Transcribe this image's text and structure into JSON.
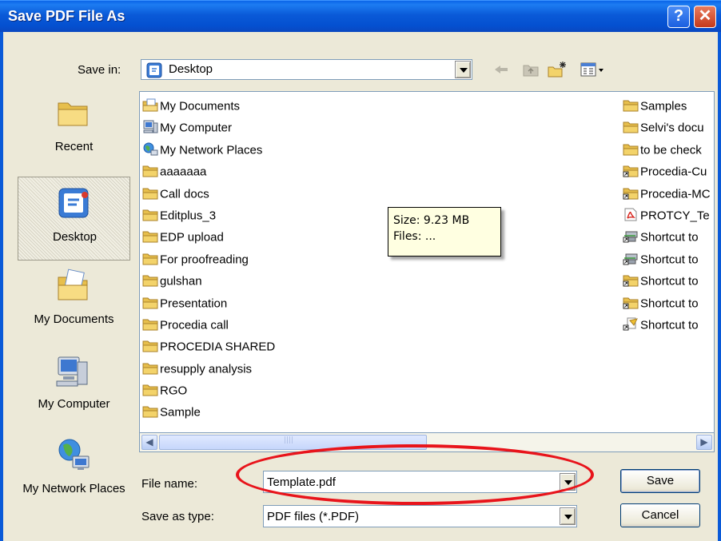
{
  "window": {
    "title": "Save PDF File As",
    "help_glyph": "?",
    "close_glyph": "✕"
  },
  "savein": {
    "label": "Save in:",
    "value": "Desktop"
  },
  "toolbar": {
    "icons": [
      "back-arrow-icon",
      "up-folder-icon",
      "new-folder-icon",
      "views-menu-icon"
    ]
  },
  "places": [
    {
      "label": "Recent",
      "icon": "recent-folder-icon"
    },
    {
      "label": "Desktop",
      "icon": "desktop-icon",
      "selected": true
    },
    {
      "label": "My Documents",
      "icon": "my-documents-icon"
    },
    {
      "label": "My Computer",
      "icon": "my-computer-icon"
    },
    {
      "label": "My Network Places",
      "icon": "network-places-icon"
    }
  ],
  "files": {
    "left_column": [
      {
        "name": "My Documents",
        "icon": "my-documents-icon"
      },
      {
        "name": "My Computer",
        "icon": "my-computer-icon"
      },
      {
        "name": "My Network Places",
        "icon": "network-places-icon"
      },
      {
        "name": "aaaaaaa",
        "icon": "folder-icon"
      },
      {
        "name": "Call docs",
        "icon": "folder-icon"
      },
      {
        "name": "Editplus_3",
        "icon": "folder-icon"
      },
      {
        "name": "EDP upload",
        "icon": "folder-icon"
      },
      {
        "name": "For proofreading",
        "icon": "folder-icon"
      },
      {
        "name": "gulshan",
        "icon": "folder-icon"
      },
      {
        "name": "Presentation",
        "icon": "folder-icon"
      },
      {
        "name": "Procedia call",
        "icon": "folder-icon"
      },
      {
        "name": "PROCEDIA SHARED",
        "icon": "folder-icon"
      },
      {
        "name": "resupply analysis",
        "icon": "folder-icon"
      },
      {
        "name": "RGO",
        "icon": "folder-icon"
      },
      {
        "name": "Sample",
        "icon": "folder-icon"
      }
    ],
    "right_column": [
      {
        "name": "Samples",
        "icon": "folder-icon"
      },
      {
        "name": "Selvi's docu",
        "icon": "folder-icon"
      },
      {
        "name": "to be check",
        "icon": "folder-icon"
      },
      {
        "name": "Procedia-Cu",
        "icon": "folder-shortcut-icon"
      },
      {
        "name": "Procedia-MC",
        "icon": "folder-shortcut-icon"
      },
      {
        "name": "PROTCY_Te",
        "icon": "pdf-file-icon"
      },
      {
        "name": "Shortcut to",
        "icon": "network-shortcut-icon"
      },
      {
        "name": "Shortcut to",
        "icon": "network-shortcut-icon"
      },
      {
        "name": "Shortcut to",
        "icon": "folder-shortcut-icon"
      },
      {
        "name": "Shortcut to",
        "icon": "folder-shortcut-icon"
      },
      {
        "name": "Shortcut to",
        "icon": "file-shortcut-icon"
      }
    ]
  },
  "tooltip": {
    "line1": "Size: 9.23 MB",
    "line2": "Files: ..."
  },
  "form": {
    "filename_label": "File name:",
    "filename_value": "Template.pdf",
    "type_label": "Save as type:",
    "type_value": "PDF files (*.PDF)",
    "save_label": "Save",
    "cancel_label": "Cancel"
  },
  "colors": {
    "titlebar": "#0a5ad8",
    "dialog_bg": "#ece9d8",
    "annotation_ellipse": "#e8141b",
    "folder_yellow": "#f3d36a"
  }
}
